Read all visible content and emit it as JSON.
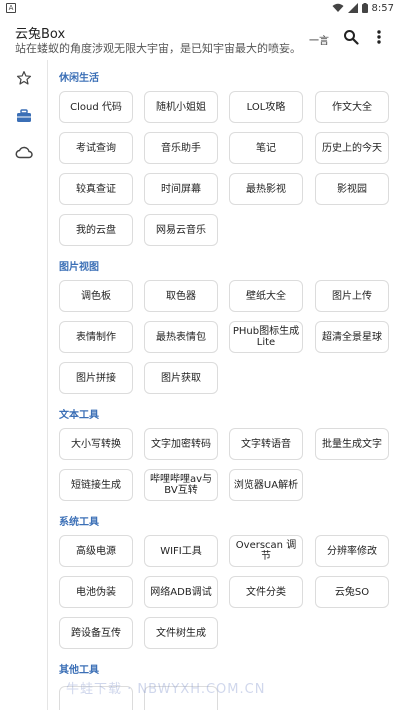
{
  "status_bar": {
    "left_icon": "A",
    "time": "8:57",
    "icons": [
      "wifi-icon",
      "signal-icon",
      "battery-icon"
    ]
  },
  "app_bar": {
    "title": "云兔Box",
    "subtitle": "站在蝼蚁的角度涉观无限大宇宙，是已知宇宙最大的喷妄。",
    "yiyan_label": "一言",
    "search_icon": "search-icon",
    "more_icon": "more-vert-icon"
  },
  "rail": {
    "items": [
      {
        "name": "favorites",
        "icon": "star-outline-icon"
      },
      {
        "name": "toolbox",
        "icon": "toolbox-icon",
        "selected": true
      },
      {
        "name": "cloud",
        "icon": "cloud-outline-icon"
      }
    ],
    "accent": "#3b6fb6"
  },
  "sections": [
    {
      "title": "休闲生活",
      "items": [
        "Cloud 代码",
        "随机小姐姐",
        "LOL攻略",
        "作文大全",
        "考试查询",
        "音乐助手",
        "笔记",
        "历史上的今天",
        "较真查证",
        "时间屏幕",
        "最热影视",
        "影视园",
        "我的云盘",
        "网易云音乐"
      ]
    },
    {
      "title": "图片视图",
      "items": [
        "调色板",
        "取色器",
        "壁纸大全",
        "图片上传",
        "表情制作",
        "最热表情包",
        "PHub图标生成Lite",
        "超清全景星球",
        "图片拼接",
        "图片获取"
      ]
    },
    {
      "title": "文本工具",
      "items": [
        "大小写转换",
        "文字加密转码",
        "文字转语音",
        "批量生成文字",
        "短链接生成",
        "哔哩哔哩av与BV互转",
        "浏览器UA解析"
      ]
    },
    {
      "title": "系统工具",
      "items": [
        "高级电源",
        "WIFI工具",
        "Overscan 调节",
        "分辨率修改",
        "电池伪装",
        "网络ADB调试",
        "文件分类",
        "云兔SO",
        "跨设备互传",
        "文件树生成"
      ]
    },
    {
      "title": "其他工具",
      "items": []
    }
  ],
  "watermark": "牛蛙下载 · NBWYXH.COM.CN"
}
